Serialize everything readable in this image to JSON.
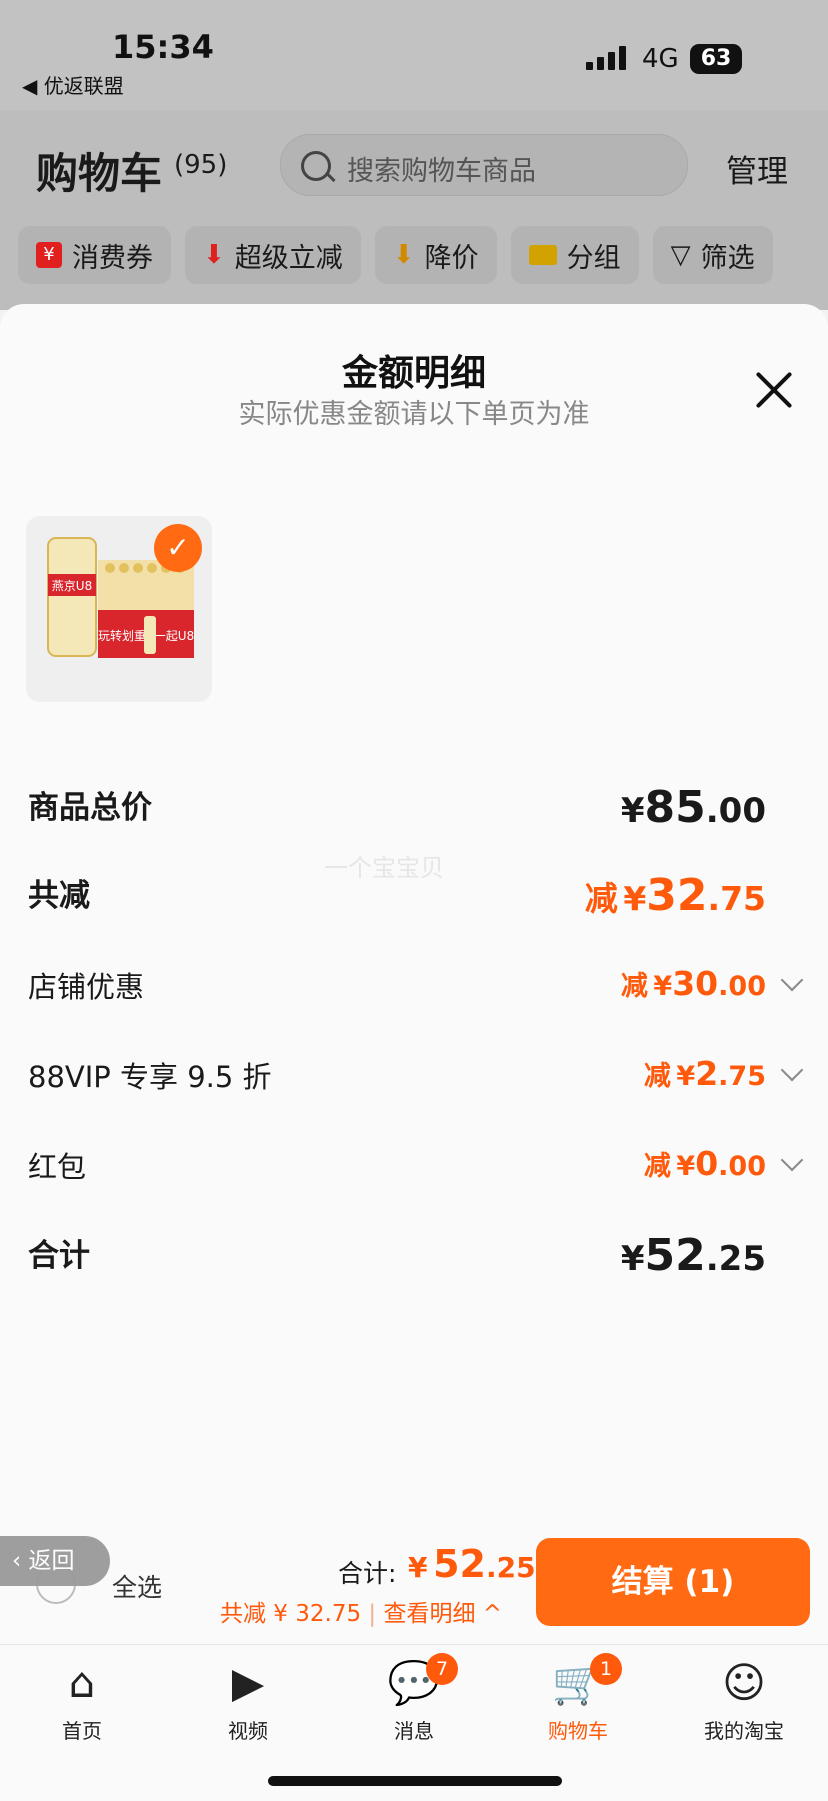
{
  "status_bar": {
    "time": "15:34",
    "back_app": "◀ 优返联盟",
    "network": "4G",
    "battery": "63"
  },
  "cart_header": {
    "title": "购物车",
    "count": "(95)",
    "search_placeholder": "搜索购物车商品",
    "manage": "管理"
  },
  "filters": [
    {
      "label": "消费券",
      "icon": "coupon-icon"
    },
    {
      "label": "超级立减",
      "icon": "arrow-down-icon"
    },
    {
      "label": "降价",
      "icon": "price-drop-icon"
    },
    {
      "label": "分组",
      "icon": "folder-icon"
    },
    {
      "label": "筛选",
      "icon": "filter-icon"
    }
  ],
  "sheet": {
    "title": "金额明细",
    "subtitle": "实际优惠金额请以下单页为准",
    "watermark": "一个宝宝贝",
    "product_image_text": {
      "brand": "燕京U8",
      "slogan": "玩转划重",
      "slogan2": "一起U8"
    },
    "rows": [
      {
        "label": "商品总价",
        "prefix": "",
        "yen": "¥",
        "int": "85",
        "dec": ".00"
      },
      {
        "label": "共减",
        "prefix": "减",
        "yen": "¥",
        "int": "32",
        "dec": ".75"
      },
      {
        "label": "店铺优惠",
        "prefix": "减",
        "yen": "¥",
        "int": "30",
        "dec": ".00"
      },
      {
        "label": "88VIP 专享 9.5 折",
        "prefix": "减",
        "yen": "¥",
        "int": "2",
        "dec": ".75"
      },
      {
        "label": "红包",
        "prefix": "减",
        "yen": "¥",
        "int": "0",
        "dec": ".00"
      },
      {
        "label": "合计",
        "prefix": "",
        "yen": "¥",
        "int": "52",
        "dec": ".25"
      }
    ]
  },
  "bottom": {
    "back": "返回",
    "select_all": "全选",
    "total_label": "合计:",
    "total_yen": "¥",
    "total_int": "52",
    "total_dec": ".25",
    "saved_text": "共减 ¥ 32.75",
    "detail_link": "查看明细",
    "checkout": "结算 (1)"
  },
  "tabs": [
    {
      "label": "首页",
      "icon": "home-icon",
      "badge": ""
    },
    {
      "label": "视频",
      "icon": "video-icon",
      "badge": ""
    },
    {
      "label": "消息",
      "icon": "message-icon",
      "badge": "7"
    },
    {
      "label": "购物车",
      "icon": "cart-icon",
      "badge": "1"
    },
    {
      "label": "我的淘宝",
      "icon": "profile-icon",
      "badge": ""
    }
  ],
  "colors": {
    "accent": "#ff5a0c",
    "button": "#ff6a12"
  }
}
